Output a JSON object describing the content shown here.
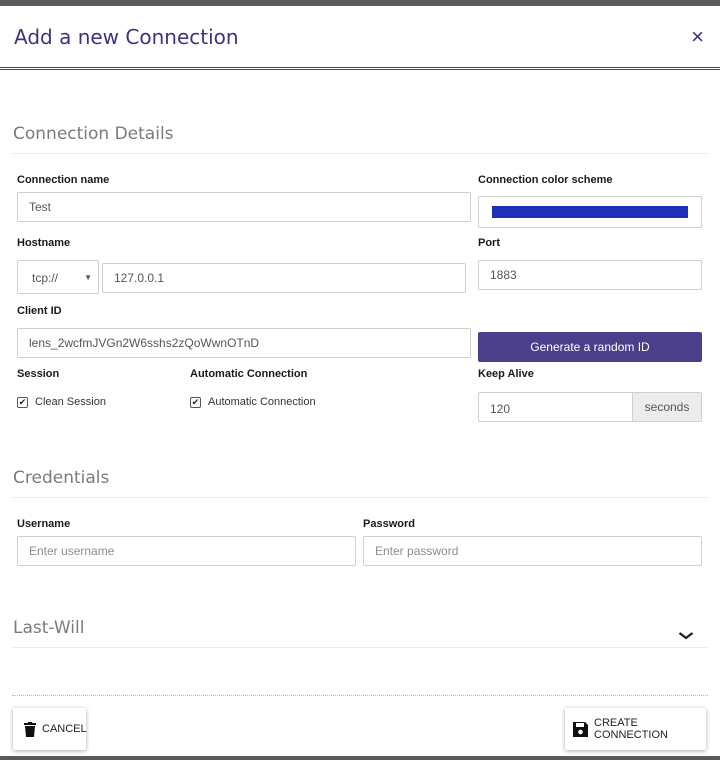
{
  "dialog": {
    "title": "Add a new Connection",
    "close_icon": "×"
  },
  "connection_details": {
    "section_title": "Connection Details",
    "connection_name_label": "Connection name",
    "connection_name_value": "Test",
    "color_scheme_label": "Connection color scheme",
    "color_scheme_value": "#1e2fb8",
    "hostname_label": "Hostname",
    "protocol_value": "tcp://",
    "hostname_value": "127.0.0.1",
    "port_label": "Port",
    "port_value": "1883",
    "client_id_label": "Client ID",
    "client_id_value": "lens_2wcfmJVGn2W6sshs2zQoWwnOTnD",
    "generate_id_label": "Generate a random ID",
    "session_label": "Session",
    "clean_session_label": "Clean Session",
    "clean_session_checked": true,
    "auto_connection_label": "Automatic Connection",
    "auto_connection_checkbox_label": "Automatic Connection",
    "auto_connection_checked": true,
    "keep_alive_label": "Keep Alive",
    "keep_alive_value": "120",
    "keep_alive_unit": "seconds"
  },
  "credentials": {
    "section_title": "Credentials",
    "username_label": "Username",
    "username_placeholder": "Enter username",
    "password_label": "Password",
    "password_placeholder": "Enter password"
  },
  "last_will": {
    "section_title": "Last-Will",
    "expand_icon": "chevron-down-icon"
  },
  "footer": {
    "cancel_label": "Cancel",
    "create_label": "Create Connection"
  },
  "colors": {
    "accent": "#4b3f8c",
    "title": "#3c3481"
  }
}
